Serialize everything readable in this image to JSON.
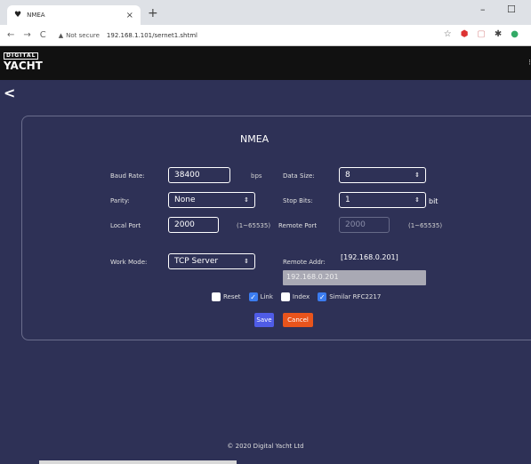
{
  "browser": {
    "tab_title": "NMEA",
    "tab_close": "×",
    "new_tab": "+",
    "minimize": "–",
    "maximize": "☐",
    "back": "←",
    "forward": "→",
    "reload": "C",
    "security_text": "Not secure",
    "url": "192.168.1.101/sernet1.shtml"
  },
  "site": {
    "logo_line1": "DIGITAL",
    "logo_line2": "YACHT",
    "back_glyph": "<"
  },
  "form": {
    "title": "NMEA",
    "baud_rate_label": "Baud Rate:",
    "baud_rate_value": "38400",
    "baud_unit": "bps",
    "data_size_label": "Data Size:",
    "data_size_value": "8",
    "parity_label": "Parity:",
    "parity_value": "None",
    "stop_bits_label": "Stop Bits:",
    "stop_bits_value": "1",
    "stop_bits_unit": "bit",
    "local_port_label": "Local Port",
    "local_port_value": "2000",
    "local_port_range": "(1~65535)",
    "remote_port_label": "Remote Port",
    "remote_port_value": "2000",
    "remote_port_range": "(1~65535)",
    "work_mode_label": "Work Mode:",
    "work_mode_value": "TCP Server",
    "remote_addr_label": "Remote Addr:",
    "remote_addr_value": "[192.168.0.201]",
    "remote_addr_input": "192.168.0.201",
    "reset_label": "Reset",
    "link_label": "Link",
    "index_label": "Index",
    "similar_label": "Similar RFC2217",
    "save_label": "Save",
    "cancel_label": "Cancel"
  },
  "footer": "© 2020 Digital Yacht Ltd"
}
